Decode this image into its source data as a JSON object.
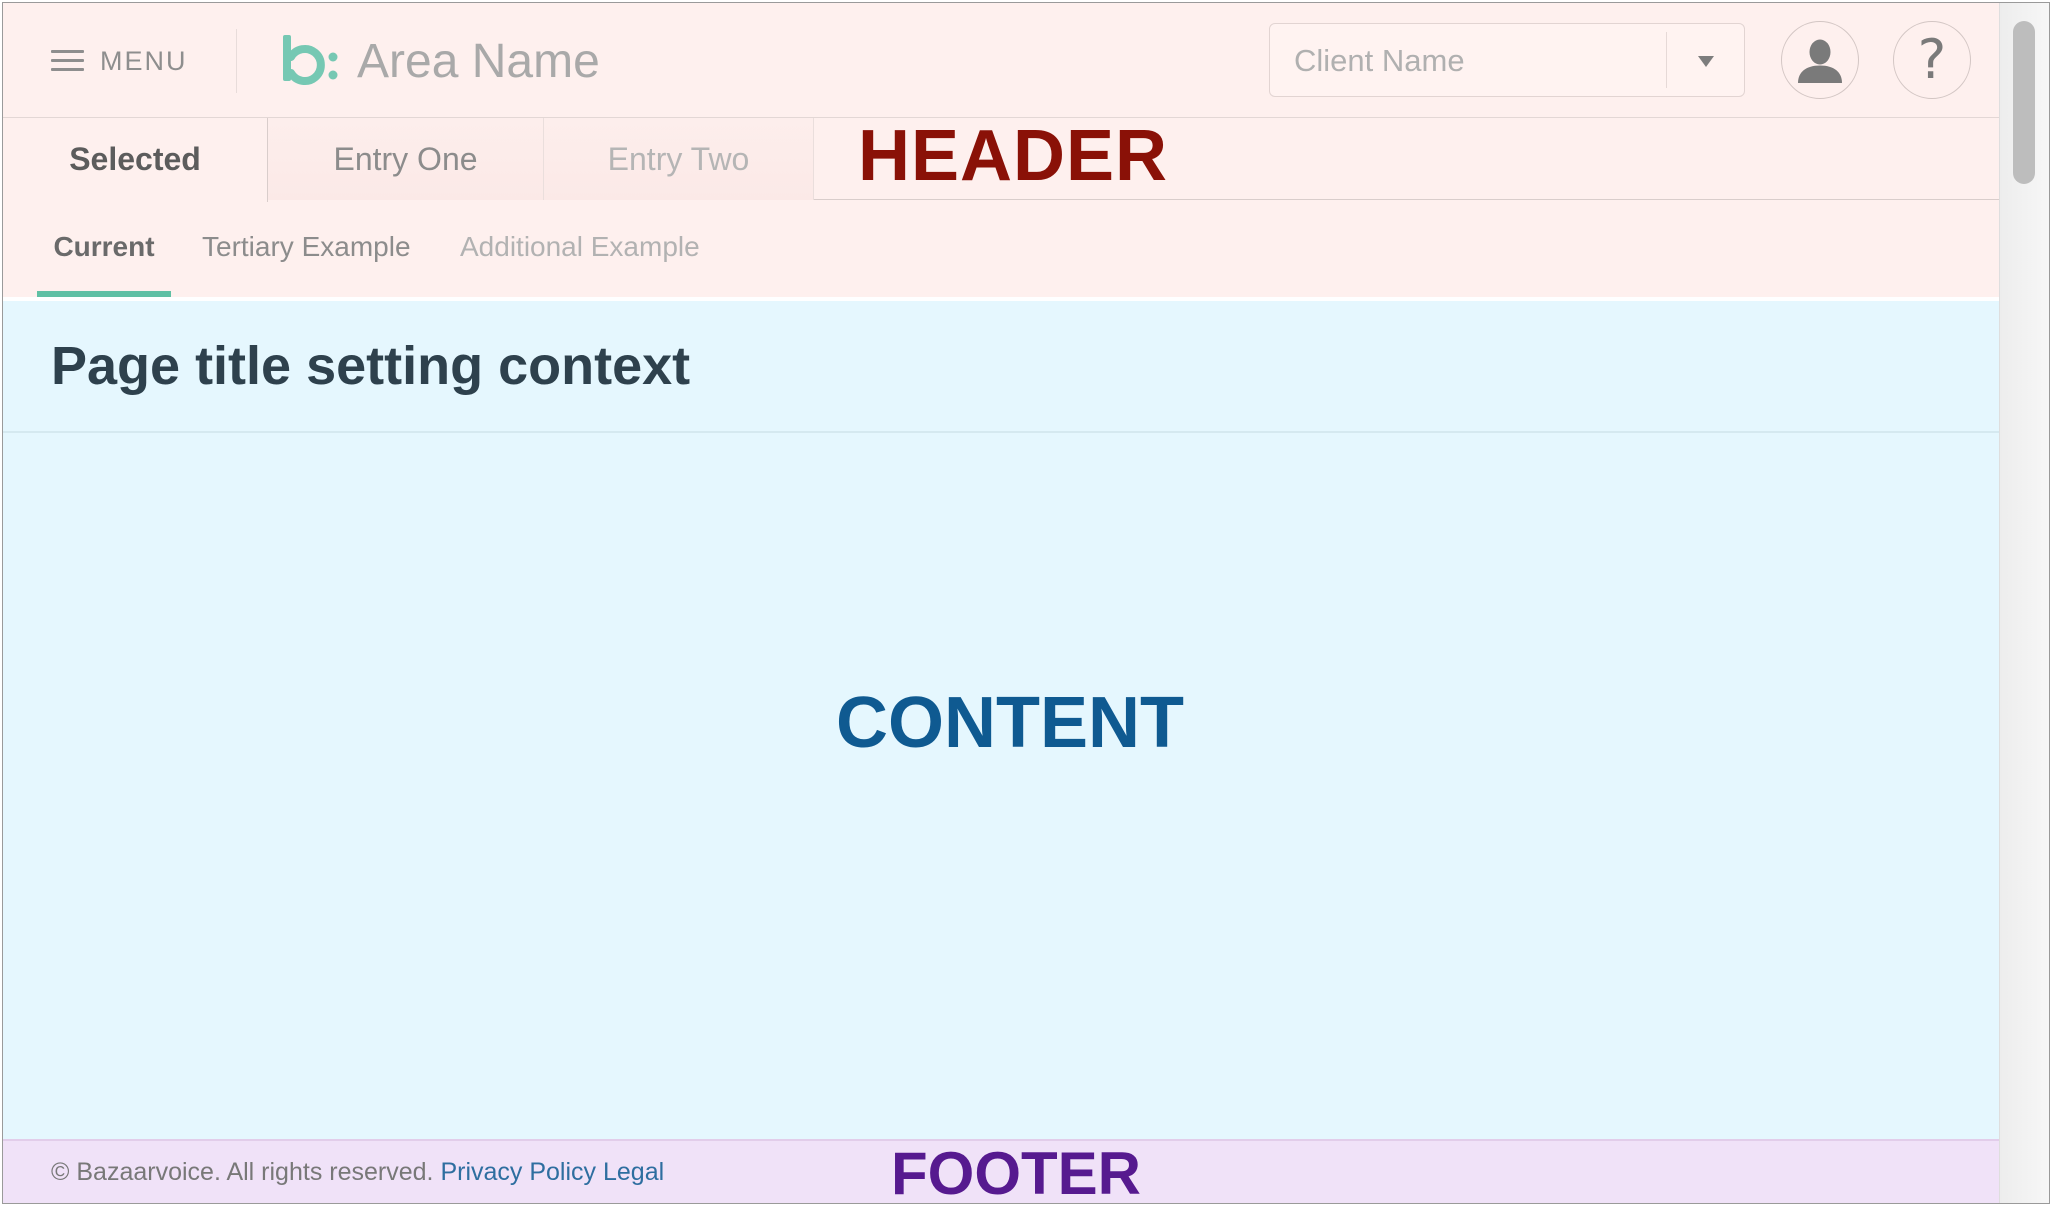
{
  "topbar": {
    "menu_label": "MENU",
    "area_name": "Area Name",
    "client_select": {
      "value": "Client Name"
    },
    "brand_color": "#5fc0a4"
  },
  "tabs": [
    {
      "label": "Selected",
      "state": "selected"
    },
    {
      "label": "Entry One",
      "state": "normal"
    },
    {
      "label": "Entry Two",
      "state": "disabled"
    }
  ],
  "subtabs": [
    {
      "label": "Current",
      "state": "active"
    },
    {
      "label": "Tertiary Example",
      "state": "normal"
    },
    {
      "label": "Additional Example",
      "state": "disabled"
    }
  ],
  "region_labels": {
    "header": "HEADER",
    "content": "CONTENT",
    "footer": "FOOTER"
  },
  "page": {
    "title": "Page title setting context"
  },
  "footer": {
    "copyright": "© Bazaarvoice. All rights reserved.",
    "privacy_link": "Privacy Policy",
    "legal_link": "Legal"
  },
  "colors": {
    "header_bg": "#fef0ee",
    "content_bg": "#e5f7fe",
    "footer_bg": "#f0e2f8",
    "header_label": "#8a1107",
    "content_label": "#0f5a91",
    "footer_label": "#561a8f",
    "active_underline": "#5fc0a4"
  },
  "icons": [
    "hamburger-icon",
    "bazaarvoice-logo",
    "chevron-down-icon",
    "user-icon",
    "help-icon"
  ]
}
